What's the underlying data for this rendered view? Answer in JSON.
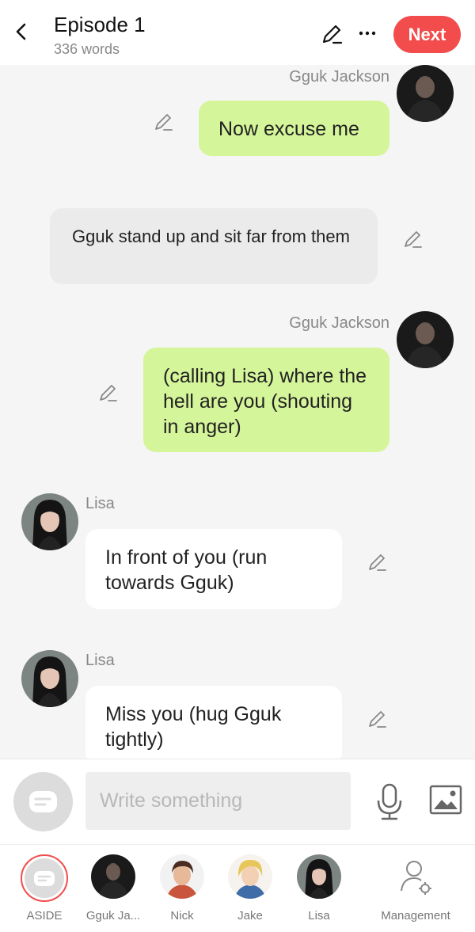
{
  "header": {
    "title": "Episode 1",
    "word_count": "336 words",
    "next_label": "Next"
  },
  "messages": [
    {
      "type": "dialogue",
      "side": "right",
      "speaker": "Gguk Jackson",
      "text": "Now excuse me"
    },
    {
      "type": "narration",
      "text": "Gguk stand up and sit far from them"
    },
    {
      "type": "dialogue",
      "side": "right",
      "speaker": "Gguk Jackson",
      "text": "(calling Lisa) where the hell are you (shouting in anger)"
    },
    {
      "type": "dialogue",
      "side": "left",
      "speaker": "Lisa",
      "text": "In front of you (run towards Gguk)"
    },
    {
      "type": "dialogue",
      "side": "left",
      "speaker": "Lisa",
      "text": "Miss you (hug Gguk tightly)"
    }
  ],
  "input": {
    "placeholder": "Write something"
  },
  "characters": [
    {
      "label": "ASIDE",
      "selected": true
    },
    {
      "label": "Gguk Ja..."
    },
    {
      "label": "Nick"
    },
    {
      "label": "Jake"
    },
    {
      "label": "Lisa"
    },
    {
      "label": "Management"
    }
  ],
  "colors": {
    "accent": "#f24c4c",
    "bubble_right": "#d5f59a",
    "bubble_left": "#ffffff",
    "narration": "#ebebeb",
    "background": "#f5f5f5"
  },
  "icons": {
    "back": "chevron-left-icon",
    "edit": "pencil-icon",
    "more": "ellipsis-icon",
    "aside": "chat-bubble-icon",
    "mic": "microphone-icon",
    "image": "image-icon",
    "management": "user-gear-icon"
  }
}
